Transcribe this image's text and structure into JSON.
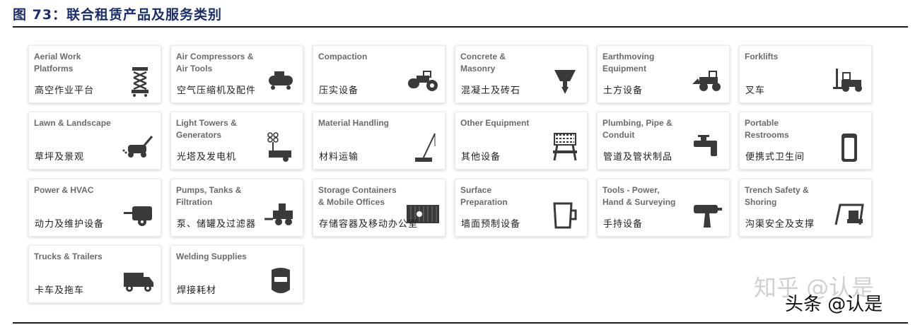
{
  "title": "图 73：联合租赁产品及服务类别",
  "categories": [
    {
      "en": "Aerial Work\nPlatforms",
      "cn": "高空作业平台",
      "icon": "scissor-lift-icon"
    },
    {
      "en": "Air Compressors &\nAir Tools",
      "cn": "空气压缩机及配件",
      "icon": "air-compressor-icon"
    },
    {
      "en": "Compaction",
      "cn": "压实设备",
      "icon": "roller-compactor-icon"
    },
    {
      "en": "Concrete &\nMasonry",
      "cn": "混凝土及砖石",
      "icon": "concrete-hopper-icon"
    },
    {
      "en": "Earthmoving\nEquipment",
      "cn": "土方设备",
      "icon": "wheel-loader-icon"
    },
    {
      "en": "Forklifts",
      "cn": "叉车",
      "icon": "forklift-icon"
    },
    {
      "en": "Lawn & Landscape",
      "cn": "草坪及景观",
      "icon": "lawn-mower-icon"
    },
    {
      "en": "Light Towers &\nGenerators",
      "cn": "光塔及发电机",
      "icon": "light-tower-icon"
    },
    {
      "en": "Material Handling",
      "cn": "材料运输",
      "icon": "crane-icon"
    },
    {
      "en": "Other Equipment",
      "cn": "其他设备",
      "icon": "barricade-icon"
    },
    {
      "en": "Plumbing, Pipe &\nConduit",
      "cn": "管道及管状制品",
      "icon": "faucet-icon"
    },
    {
      "en": "Portable\nRestrooms",
      "cn": "便携式卫生间",
      "icon": "portable-toilet-icon"
    },
    {
      "en": "Power & HVAC",
      "cn": "动力及维护设备",
      "icon": "hvac-unit-icon"
    },
    {
      "en": "Pumps, Tanks &\nFiltration",
      "cn": "泵、储罐及过滤器",
      "icon": "pump-trailer-icon"
    },
    {
      "en": "Storage Containers\n& Mobile Offices",
      "cn": "存储容器及移动办公室",
      "icon": "storage-container-icon"
    },
    {
      "en": "Surface\nPreparation",
      "cn": "墙面预制设备",
      "icon": "paint-bucket-icon"
    },
    {
      "en": "Tools - Power,\nHand & Surveying",
      "cn": "手持设备",
      "icon": "power-drill-icon"
    },
    {
      "en": "Trench Safety &\nShoring",
      "cn": "沟渠安全及支撑",
      "icon": "trench-box-icon"
    },
    {
      "en": "Trucks & Trailers",
      "cn": "卡车及拖车",
      "icon": "truck-icon"
    },
    {
      "en": "Welding Supplies",
      "cn": "焊接耗材",
      "icon": "welding-mask-icon"
    }
  ],
  "watermarks": [
    "知乎 @认是",
    "头条 @认是"
  ],
  "colors": {
    "title": "#1a2e6b",
    "label": "#6b6b6b",
    "icon": "#3a3a3a"
  }
}
